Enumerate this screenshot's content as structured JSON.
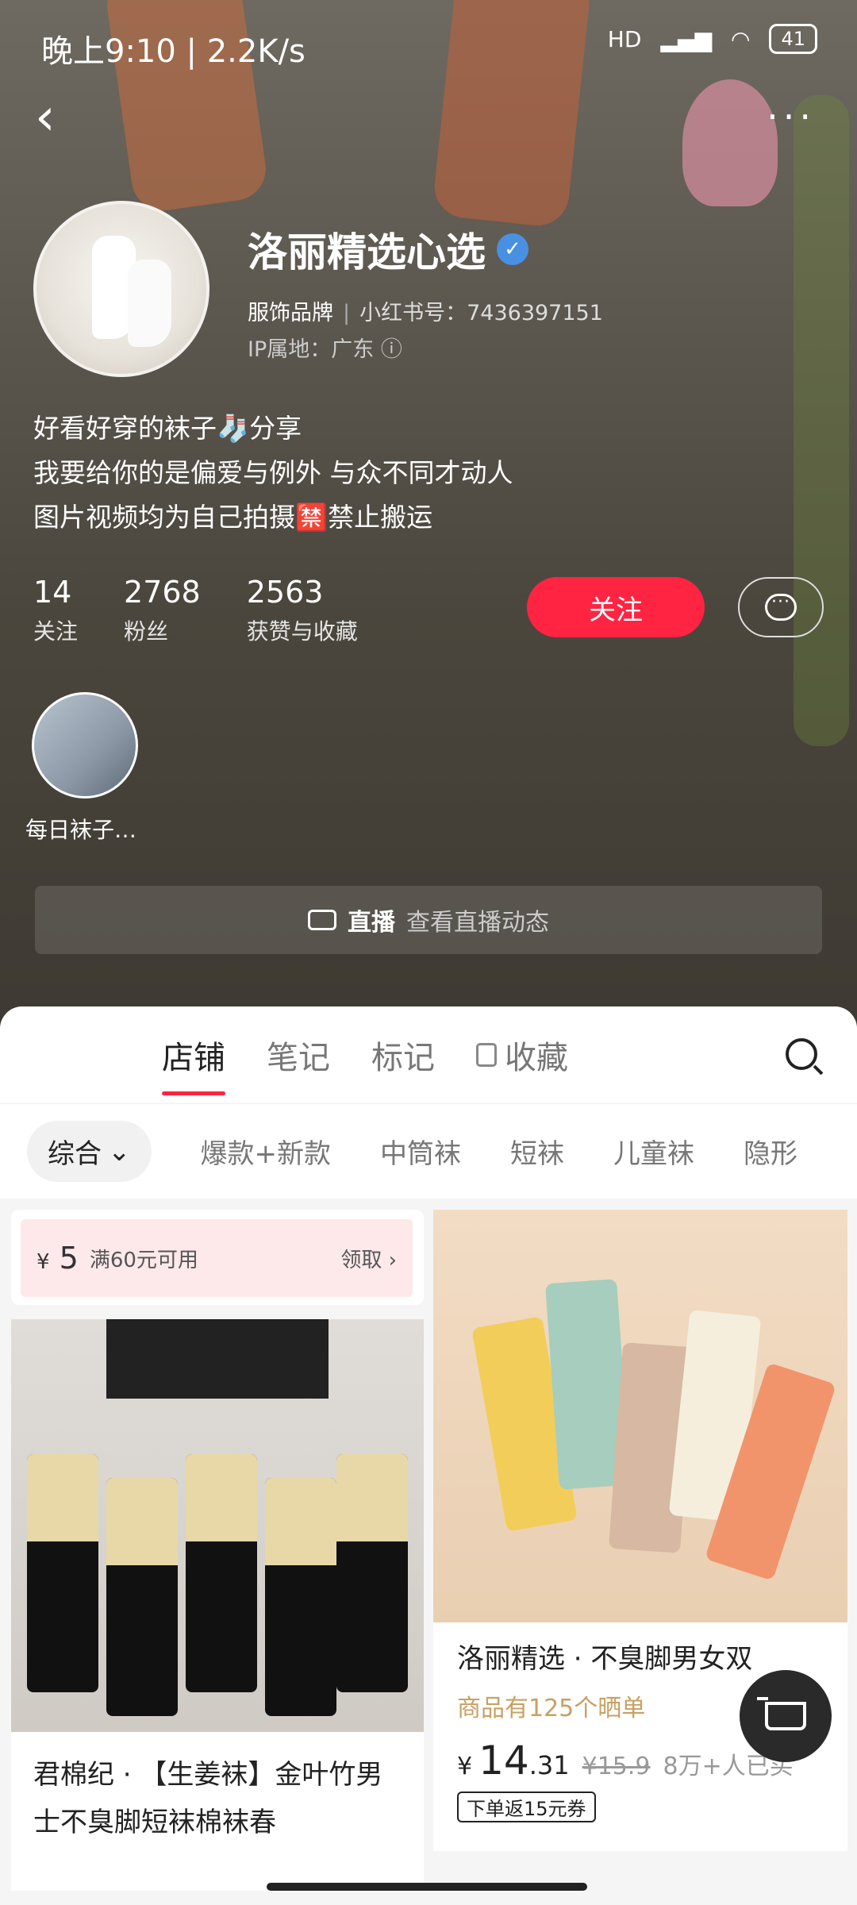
{
  "status_bar": {
    "time": "晚上9:10 | 2.2K/s",
    "battery": "41",
    "network": "HD"
  },
  "profile": {
    "name": "洛丽精选心选",
    "category": "服饰品牌",
    "red_id": "小红书号：7436397151",
    "ip": "IP属地：广东",
    "bio": [
      "好看好穿的袜子🧦分享",
      "我要给你的是偏爱与例外 与众不同才动人",
      "图片视频均为自己拍摄🈲禁止搬运"
    ],
    "stats": [
      {
        "value": "14",
        "label": "关注"
      },
      {
        "value": "2768",
        "label": "粉丝"
      },
      {
        "value": "2563",
        "label": "获赞与收藏"
      }
    ],
    "follow_label": "关注",
    "highlight_label": "每日袜子…",
    "live_label": "直播",
    "live_sub": "查看直播动态"
  },
  "tabs": [
    "店铺",
    "笔记",
    "标记",
    "收藏"
  ],
  "filters": {
    "selected": "综合",
    "items": [
      "爆款+新款",
      "中筒袜",
      "短袜",
      "儿童袜",
      "隐形"
    ]
  },
  "coupon": {
    "currency": "¥",
    "amount": "5",
    "condition": "满60元可用",
    "action": "领取"
  },
  "products": [
    {
      "title": "君棉纪 · 【生姜袜】金叶竹男士不臭脚短袜棉袜春"
    },
    {
      "title": "洛丽精选 · 不臭脚男女双",
      "reviews": "商品有125个晒单",
      "currency": "¥",
      "price_int": "14",
      "price_dec": ".31",
      "old_price": "¥15.9",
      "sold": "8万+人已买",
      "tag": "下单返15元券"
    }
  ]
}
